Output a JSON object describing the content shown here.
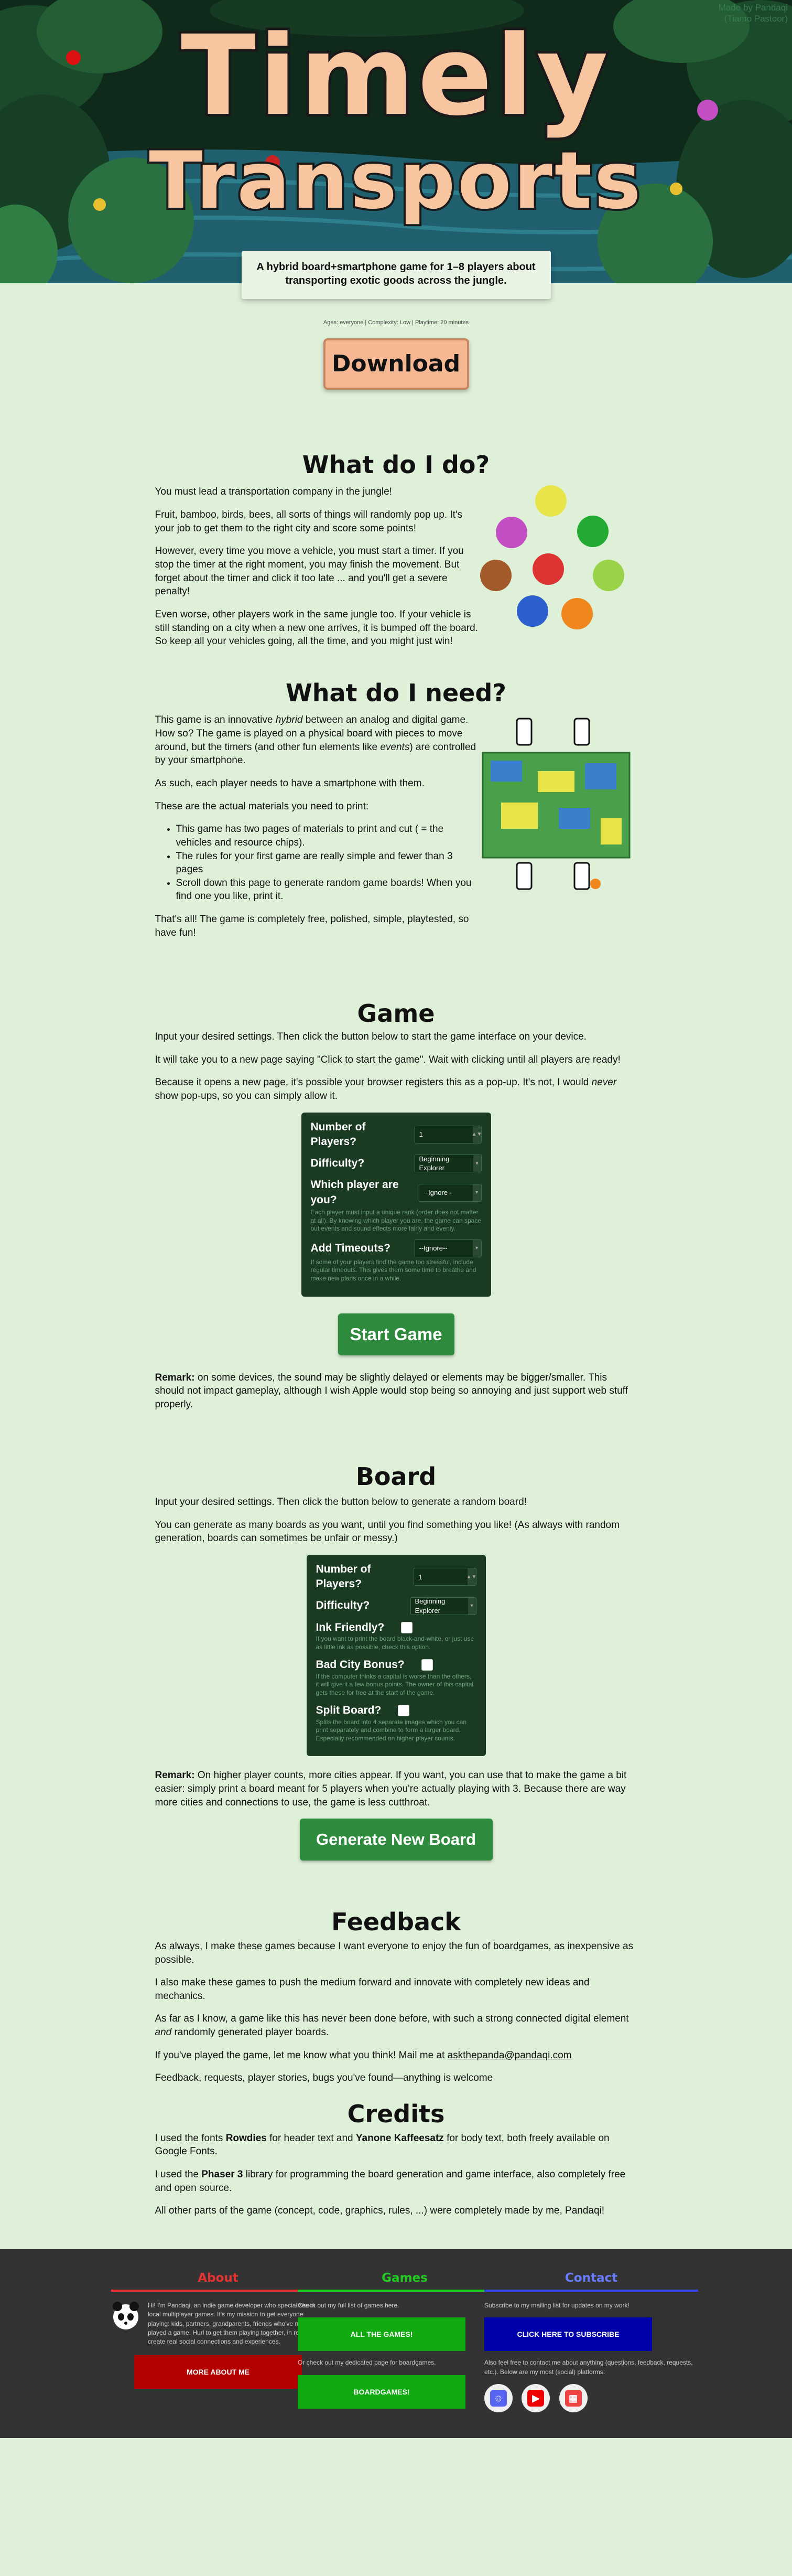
{
  "header": {
    "made_by_line1": "Made by Pandaqi",
    "made_by_line2": "(Tiamo Pastoor)",
    "title_line1": "Timely",
    "title_line2": "Transports",
    "tagline": "A hybrid board+smartphone game for 1–8 players about transporting exotic goods across the jungle.",
    "meta": "Ages: everyone | Complexity: Low | Playtime: 20 minutes",
    "download_label": "Download"
  },
  "what_do_i_do": {
    "heading": "What do I do?",
    "p1": "You must lead a transportation company in the jungle!",
    "p2": "Fruit, bamboo, birds, bees, all sorts of things will randomly pop up. It's your job to get them to the right city and score some points!",
    "p3": "However, every time you move a vehicle, you must start a timer. If you stop the timer at the right moment, you may finish the movement. But forget about the timer and click it too late ... and you'll get a severe penalty!",
    "p4": "Even worse, other players work in the same jungle too. If your vehicle is still standing on a city when a new one arrives, it is bumped off the board. So keep all your vehicles going, all the time, and you might just win!"
  },
  "what_do_i_need": {
    "heading": "What do I need?",
    "p1_a": "This game is an innovative ",
    "p1_em": "hybrid",
    "p1_b": " between an analog and digital game. How so? The game is played on a physical board with pieces to move around, but the timers (and other fun elements like ",
    "p1_em2": "events",
    "p1_c": ") are controlled by your smartphone.",
    "p2": "As such, each player needs to have a smartphone with them.",
    "p3": "These are the actual materials you need to print:",
    "items": [
      "This game has two pages of materials to print and cut ( = the vehicles and resource chips).",
      "The rules for your first game are really simple and fewer than 3 pages",
      "Scroll down this page to generate random game boards! When you find one you like, print it."
    ],
    "p4": "That's all! The game is completely free, polished, simple, playtested, so have fun!"
  },
  "game": {
    "heading": "Game",
    "p1": "Input your desired settings. Then click the button below to start the game interface on your device.",
    "p2": "It will take you to a new page saying \"Click to start the game\". Wait with clicking until all players are ready!",
    "p3_a": "Because it opens a new page, it's possible your browser registers this as a pop-up. It's not, I would ",
    "p3_em": "never",
    "p3_b": " show pop-ups, so you can simply allow it.",
    "settings": {
      "players_label": "Number of Players?",
      "players_value": "1",
      "difficulty_label": "Difficulty?",
      "difficulty_value": "Beginning Explorer",
      "which_label": "Which player are you?",
      "which_value": "--Ignore--",
      "which_help": "Each player must input a unique rank (order does not matter at all). By knowing which player you are, the game can space out events and sound effects more fairly and evenly.",
      "timeouts_label": "Add Timeouts?",
      "timeouts_value": "--Ignore--",
      "timeouts_help": "If some of your players find the game too stressful, include regular timeouts. This gives them some time to breathe and make new plans once in a while."
    },
    "start_label": "Start Game",
    "remark_bold": "Remark:",
    "remark_text": " on some devices, the sound may be slightly delayed or elements may be bigger/smaller. This should not impact gameplay, although I wish Apple would stop being so annoying and just support web stuff properly."
  },
  "board": {
    "heading": "Board",
    "p1": "Input your desired settings. Then click the button below to generate a random board!",
    "p2": "You can generate as many boards as you want, until you find something you like! (As always with random generation, boards can sometimes be unfair or messy.)",
    "settings": {
      "players_label": "Number of Players?",
      "players_value": "1",
      "difficulty_label": "Difficulty?",
      "difficulty_value": "Beginning Explorer",
      "ink_label": "Ink Friendly?",
      "ink_help": "If you want to print the board black-and-white, or just use as little ink as possible, check this option.",
      "bad_label": "Bad City Bonus?",
      "bad_help": "If the computer thinks a capital is worse than the others, it will give it a few bonus points. The owner of this capital gets these for free at the start of the game.",
      "split_label": "Split Board?",
      "split_help": "Splits the board into 4 separate images which you can print separately and combine to form a larger board. Especially recommended on higher player counts."
    },
    "remark_bold": "Remark:",
    "remark_text": " On higher player counts, more cities appear. If you want, you can use that to make the game a bit easier: simply print a board meant for 5 players when you're actually playing with 3. Because there are way more cities and connections to use, the game is less cutthroat.",
    "generate_label": "Generate New Board"
  },
  "feedback": {
    "heading": "Feedback",
    "p1": "As always, I make these games because I want everyone to enjoy the fun of boardgames, as inexpensive as possible.",
    "p2": "I also make these games to push the medium forward and innovate with completely new ideas and mechanics.",
    "p3_a": "As far as I know, a game like this has never been done before, with such a strong connected digital element ",
    "p3_em": "and",
    "p3_b": " randomly generated player boards.",
    "p4_a": "If you've played the game, let me know what you think! Mail me at ",
    "email": "askthepanda@pandaqi.com",
    "p5": "Feedback, requests, player stories, bugs you've found—anything is welcome"
  },
  "credits": {
    "heading": "Credits",
    "p1_a": "I used the fonts ",
    "font1": "Rowdies",
    "p1_b": " for header text and ",
    "font2": "Yanone Kaffeesatz",
    "p1_c": " for body text, both freely available on Google Fonts.",
    "p2_a": "I used the ",
    "lib": "Phaser 3",
    "p2_b": " library for programming the board generation and game interface, also completely free and open source.",
    "p3": "All other parts of the game (concept, code, graphics, rules, ...) were completely made by me, Pandaqi!"
  },
  "footer": {
    "about_title": "About",
    "about_text": "Hi! I'm Pandaqi, an indie game developer who specializes in local multiplayer games. It's my mission to get everyone playing: kids, partners, grandparents, friends who've never played a game. Hurl to get them playing together, in real life, to create real social connections and experiences.",
    "about_btn": "MORE ABOUT ME",
    "games_title": "Games",
    "games_text1": "Check out my full list of games here.",
    "games_btn1": "ALL THE GAMES!",
    "games_text2": "Or check out my dedicated page for boardgames.",
    "games_btn2": "BOARDGAMES!",
    "contact_title": "Contact",
    "contact_text1": "Subscribe to my mailing list for updates on my work!",
    "contact_btn": "CLICK HERE TO SUBSCRIBE",
    "contact_text2": "Also feel free to contact me about anything (questions, feedback, requests, etc.). Below are my most (social) platforms:",
    "colors": {
      "about": "#e63333",
      "games": "#22cc22",
      "contact": "#3344ee"
    }
  }
}
